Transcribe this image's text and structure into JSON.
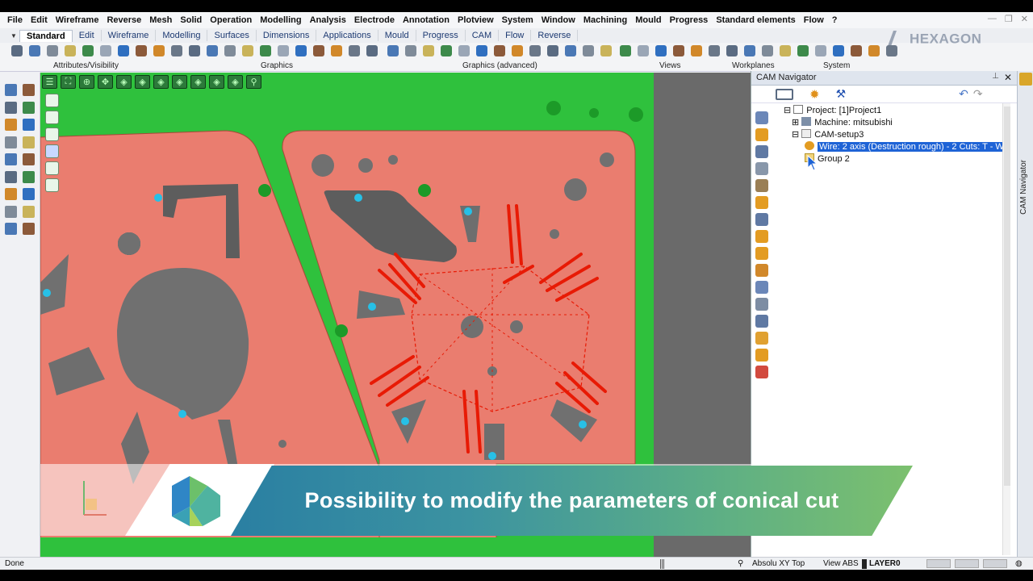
{
  "menu": [
    "File",
    "Edit",
    "Wireframe",
    "Reverse",
    "Mesh",
    "Solid",
    "Operation",
    "Modelling",
    "Analysis",
    "Electrode",
    "Annotation",
    "Plotview",
    "System",
    "Window",
    "Machining",
    "Mould",
    "Progress",
    "Standard elements",
    "Flow",
    "?"
  ],
  "tabs": [
    "Standard",
    "Edit",
    "Wireframe",
    "Modelling",
    "Surfaces",
    "Dimensions",
    "Applications",
    "Mould",
    "Progress",
    "CAM",
    "Flow",
    "Reverse"
  ],
  "active_tab": "Standard",
  "toolbar_groups": {
    "attributes": "Attributes/Visibility",
    "graphics": "Graphics",
    "graphics_advanced": "Graphics (advanced)",
    "views": "Views",
    "workplanes": "Workplanes",
    "system": "System"
  },
  "brand": "HEXAGON",
  "cam_navigator": {
    "title": "CAM Navigator",
    "vertical_tab": "CAM Navigator",
    "tree": {
      "project": "Project: [1]Project1",
      "machine": "Machine: mitsubishi",
      "setup": "CAM-setup3",
      "operation": "Wire: 2 axis (Destruction rough)  - 2 Cuts: T - Wi",
      "group": "Group 2"
    }
  },
  "banner": {
    "text": "Possibility to modify the parameters of conical cut"
  },
  "status": {
    "left": "Done",
    "view_mode": "Absolu XY Top",
    "view_abs": "View ABS",
    "layer": "LAYER0"
  },
  "colors": {
    "background_green": "#2fc13d",
    "part_salmon": "#ea7d6f",
    "hole_gray": "#707070",
    "toolpath_red": "#e81a05",
    "selection_blue": "#1e63d6",
    "marker_cyan": "#27c0e6"
  }
}
